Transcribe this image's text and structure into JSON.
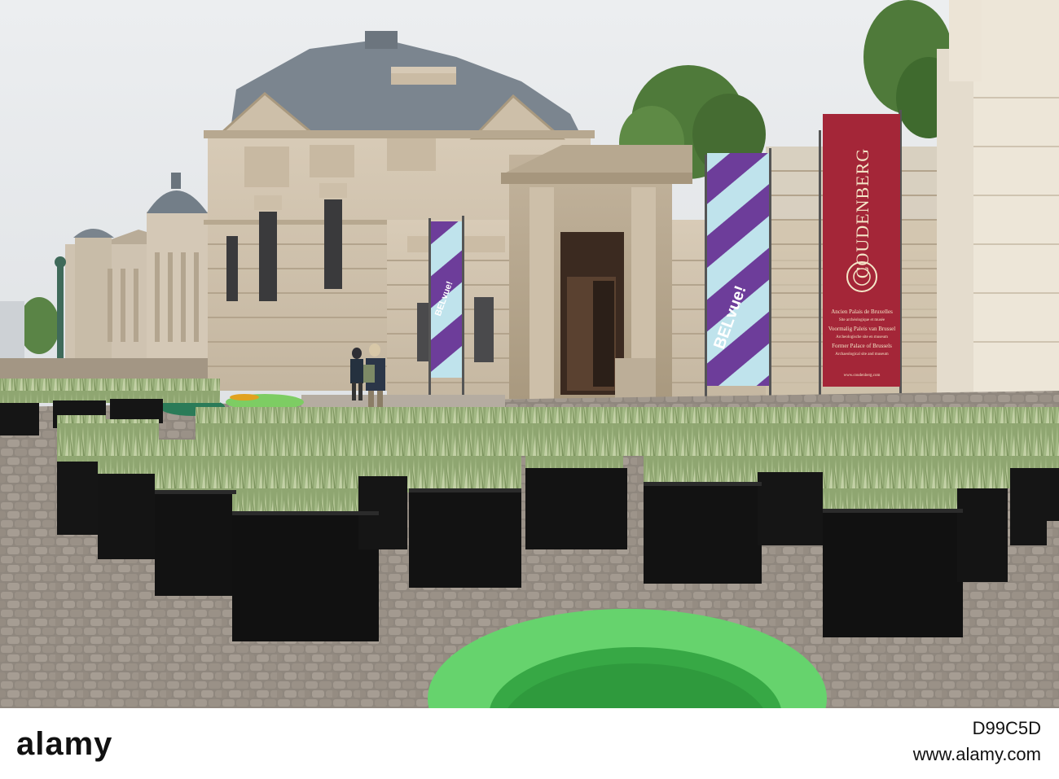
{
  "photo": {
    "banner_right": {
      "title": "COUDENBERG",
      "lines": [
        "Ancien Palais de Bruxelles",
        "Site archéologique et musée",
        "Voormalig Paleis van Brussel",
        "Archeologische site en museum",
        "Former Palace of Brussels",
        "Archaeological site and museum"
      ],
      "url": "www.coudenberg.com",
      "color": "#a42638"
    },
    "banner_belvue": {
      "label": "BELvue!",
      "stripe_colors": [
        "#6d3d9a",
        "#bfe3ec"
      ]
    },
    "planter_grass_color": "#9db37f",
    "seat_color": "#66d36d"
  },
  "stock_bar": {
    "logo": "alamy",
    "image_id": "D99C5D",
    "url": "www.alamy.com"
  }
}
